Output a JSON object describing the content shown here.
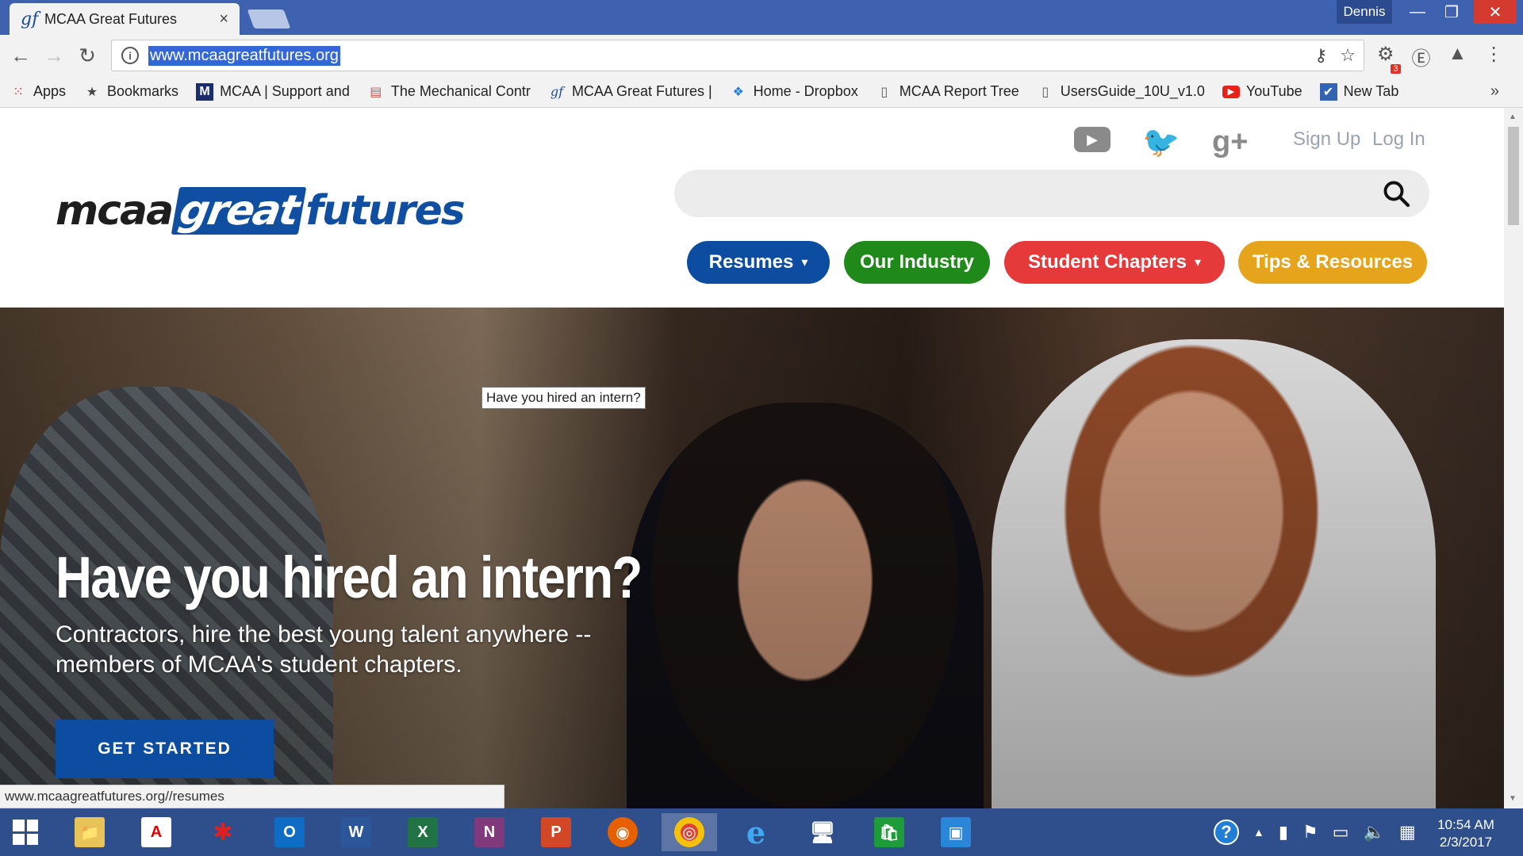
{
  "browser": {
    "tab_title": "MCAA Great Futures",
    "tab_favicon": "gf",
    "tab_close": "×",
    "user": "Dennis",
    "url": "www.mcaagreatfutures.org",
    "status_url": "www.mcaagreatfutures.org//resumes",
    "ext_badge": "3",
    "bookmarks": [
      {
        "label": "Apps",
        "icon": "apps-grid-icon"
      },
      {
        "label": "Bookmarks",
        "icon": "star-icon"
      },
      {
        "label": "MCAA | Support and",
        "icon": "mcaa-icon"
      },
      {
        "label": "The Mechanical Contr",
        "icon": "page-icon"
      },
      {
        "label": "MCAA Great Futures |",
        "icon": "gf-icon"
      },
      {
        "label": "Home - Dropbox",
        "icon": "dropbox-icon"
      },
      {
        "label": "MCAA Report Tree",
        "icon": "document-icon"
      },
      {
        "label": "UsersGuide_10U_v1.0",
        "icon": "document-icon"
      },
      {
        "label": "YouTube",
        "icon": "youtube-icon"
      },
      {
        "label": "New Tab",
        "icon": "newtab-icon"
      }
    ],
    "bookmarks_more": "»"
  },
  "site": {
    "logo": {
      "part1": "mcaa",
      "part2": "great",
      "part3": "futures"
    },
    "auth": {
      "signup": "Sign Up",
      "login": "Log In"
    },
    "social": {
      "twitter": "🐦",
      "gplus": "g+"
    },
    "nav": [
      {
        "label": "Resumes",
        "has_dropdown": true
      },
      {
        "label": "Our Industry",
        "has_dropdown": false
      },
      {
        "label": "Student Chapters",
        "has_dropdown": true
      },
      {
        "label": "Tips & Resources",
        "has_dropdown": false
      }
    ],
    "nav_colors": {
      "resumes": "#0c4da2",
      "industry": "#1f8a1a",
      "chapters": "#e6393a",
      "tips": "#e5a41b"
    },
    "hero": {
      "tooltip": "Have you hired an intern?",
      "title": "Have you hired an intern?",
      "subtitle": "Contractors, hire the best young talent anywhere -- members of MCAA's student chapters.",
      "cta": "GET STARTED",
      "slides": 4,
      "active_slide": 1
    }
  },
  "taskbar": {
    "apps": [
      {
        "name": "file-explorer",
        "glyph": "📁"
      },
      {
        "name": "acrobat",
        "glyph": "A"
      },
      {
        "name": "paint-app",
        "glyph": "✱"
      },
      {
        "name": "outlook",
        "glyph": "O"
      },
      {
        "name": "word",
        "glyph": "W"
      },
      {
        "name": "excel",
        "glyph": "X"
      },
      {
        "name": "onenote",
        "glyph": "N"
      },
      {
        "name": "powerpoint",
        "glyph": "P"
      },
      {
        "name": "firefox",
        "glyph": "◉"
      },
      {
        "name": "chrome",
        "glyph": "◎"
      },
      {
        "name": "internet-explorer",
        "glyph": "e"
      },
      {
        "name": "remote-desktop",
        "glyph": "🖥"
      },
      {
        "name": "store",
        "glyph": "🛍"
      },
      {
        "name": "photos",
        "glyph": "▣"
      }
    ],
    "clock_time": "10:54 AM",
    "clock_date": "2/3/2017"
  }
}
